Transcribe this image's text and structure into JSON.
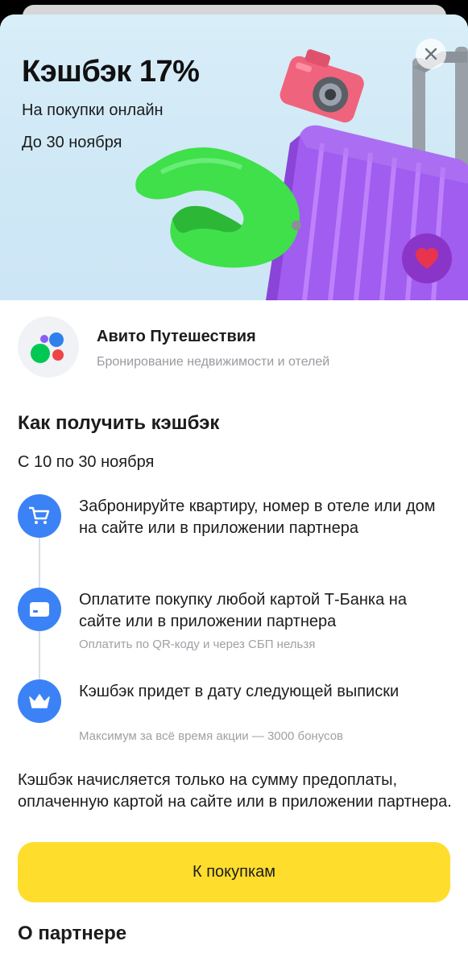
{
  "hero": {
    "title": "Кэшбэк 17%",
    "subtitle_1": "На покупки онлайн",
    "subtitle_2": "До 30 ноября",
    "close_icon": "close-icon",
    "heart_icon": "heart-icon",
    "colors": {
      "background": "#d8eef8",
      "heart_button": "#8a35c8",
      "heart": "#e8344e"
    }
  },
  "partner": {
    "name": "Авито Путешествия",
    "description": "Бронирование недвижимости и отелей",
    "logo_colors": [
      "#2f80ed",
      "#00c853",
      "#ef4444",
      "#8b5cf6"
    ]
  },
  "how_to": {
    "title": "Как получить кэшбэк",
    "period": "С 10 по 30 ноября",
    "steps": [
      {
        "icon": "cart-icon",
        "text": "Забронируйте квартиру, номер в отеле или дом на сайте или в приложении партнера",
        "note": ""
      },
      {
        "icon": "card-icon",
        "text": "Оплатите покупку любой картой Т-Банка на сайте или в приложении партнера",
        "note": "Оплатить по QR-коду и через СБП нельзя"
      },
      {
        "icon": "crown-icon",
        "text": "Кэшбэк придет в дату следующей выписки",
        "note": "Максимум за всё время акции — 3000 бонусов"
      }
    ]
  },
  "disclaimer": "Кэшбэк начисляется только на сумму предоплаты, оплаченную картой на сайте или в приложении партнера.",
  "cta": {
    "label": "К покупкам",
    "color": "#ffdd2d"
  },
  "about": {
    "title": "О партнере"
  },
  "accent_color": "#3b82f6"
}
